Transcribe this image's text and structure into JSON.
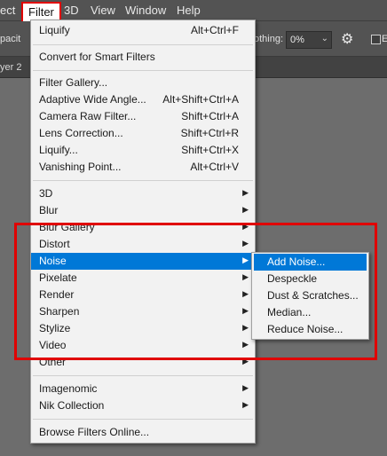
{
  "menubar": {
    "items": [
      {
        "label": "ect"
      },
      {
        "label": "Filter"
      },
      {
        "label": "3D"
      },
      {
        "label": "View"
      },
      {
        "label": "Window"
      },
      {
        "label": "Help"
      }
    ]
  },
  "options_bar": {
    "opacity_label": "pacit",
    "smoothing_label": "othing:",
    "smoothing_value": "0%",
    "checkbox_label": "E"
  },
  "doc_tab": {
    "label": "yer 2"
  },
  "filter_menu": {
    "last_filter": {
      "label": "Liquify",
      "shortcut": "Alt+Ctrl+F"
    },
    "convert": {
      "label": "Convert for Smart Filters"
    },
    "filters": [
      {
        "label": "Filter Gallery...",
        "shortcut": ""
      },
      {
        "label": "Adaptive Wide Angle...",
        "shortcut": "Alt+Shift+Ctrl+A"
      },
      {
        "label": "Camera Raw Filter...",
        "shortcut": "Shift+Ctrl+A"
      },
      {
        "label": "Lens Correction...",
        "shortcut": "Shift+Ctrl+R"
      },
      {
        "label": "Liquify...",
        "shortcut": "Shift+Ctrl+X"
      },
      {
        "label": "Vanishing Point...",
        "shortcut": "Alt+Ctrl+V"
      }
    ],
    "groups": [
      {
        "label": "3D"
      },
      {
        "label": "Blur"
      },
      {
        "label": "Blur Gallery"
      },
      {
        "label": "Distort"
      },
      {
        "label": "Noise"
      },
      {
        "label": "Pixelate"
      },
      {
        "label": "Render"
      },
      {
        "label": "Sharpen"
      },
      {
        "label": "Stylize"
      },
      {
        "label": "Video"
      },
      {
        "label": "Other"
      }
    ],
    "plugins": [
      {
        "label": "Imagenomic"
      },
      {
        "label": "Nik Collection"
      }
    ],
    "browse": {
      "label": "Browse Filters Online..."
    }
  },
  "noise_submenu": {
    "items": [
      {
        "label": "Add Noise..."
      },
      {
        "label": "Despeckle"
      },
      {
        "label": "Dust & Scratches..."
      },
      {
        "label": "Median..."
      },
      {
        "label": "Reduce Noise..."
      }
    ]
  },
  "colors": {
    "highlight": "#0078d7",
    "annotation_red": "#e00000",
    "menu_bg": "#f2f2f2",
    "app_bg": "#535353"
  },
  "icons": {
    "submenu_arrow": "triangle-right-icon",
    "settings": "gear-icon",
    "dropdown": "chevron-down-icon"
  }
}
